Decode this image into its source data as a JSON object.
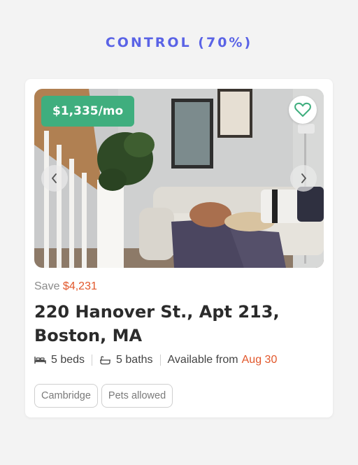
{
  "variant": {
    "label": "CONTROL (70%)"
  },
  "listing": {
    "price_badge": "$1,335/mo",
    "save_prefix": "Save",
    "save_amount": "$4,231",
    "address": "220 Hanover St., Apt 213, Boston, MA",
    "beds": "5 beds",
    "baths": "5 baths",
    "availability_prefix": "Available from",
    "availability_date": "Aug 30",
    "tags": [
      "Cambridge",
      "Pets allowed"
    ]
  },
  "icons": {
    "favorite": "heart-outline-icon",
    "prev": "chevron-left-icon",
    "next": "chevron-right-icon",
    "beds": "bed-icon",
    "baths": "bathtub-icon"
  },
  "colors": {
    "accent_label": "#5a63e6",
    "price_badge_bg": "#3fae7e",
    "highlight": "#e2572b",
    "favorite_icon": "#3fae7e"
  }
}
